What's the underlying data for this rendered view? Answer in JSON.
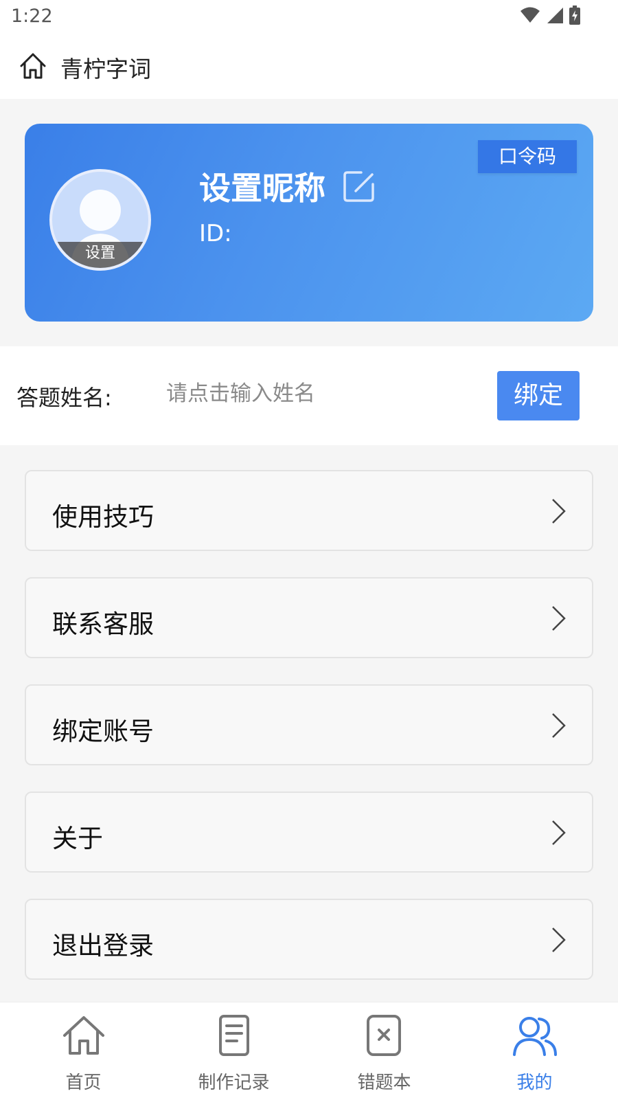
{
  "status_bar": {
    "time": "1:22"
  },
  "app_bar": {
    "title": "青柠字词",
    "home_icon": "home-icon"
  },
  "profile": {
    "nickname": "设置昵称",
    "id_label": "ID:",
    "avatar_caption": "设置",
    "passcode_button": "口令码",
    "gradient_start": "#3a7fe8",
    "gradient_end": "#5ca9f3"
  },
  "bind": {
    "label": "答题姓名:",
    "placeholder": "请点击输入姓名",
    "value": "",
    "button": "绑定"
  },
  "menu": [
    {
      "label": "使用技巧"
    },
    {
      "label": "联系客服"
    },
    {
      "label": "绑定账号"
    },
    {
      "label": "关于"
    },
    {
      "label": "退出登录"
    }
  ],
  "tabs": [
    {
      "label": "首页",
      "icon": "home-icon",
      "active": false
    },
    {
      "label": "制作记录",
      "icon": "document-icon",
      "active": false
    },
    {
      "label": "错题本",
      "icon": "notebook-icon",
      "active": false
    },
    {
      "label": "我的",
      "icon": "users-icon",
      "active": true
    }
  ],
  "colors": {
    "accent": "#3a7fe8",
    "button": "#4a89f0",
    "text_muted": "#8a8a8a"
  }
}
